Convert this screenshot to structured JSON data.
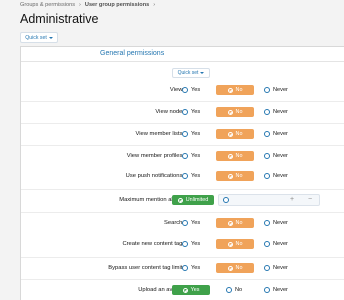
{
  "breadcrumbs": [
    "Groups & permissions",
    "User group permissions"
  ],
  "page_title": "Administrative",
  "quick_set_label": "Quick set",
  "section_title": "General permissions",
  "option_labels": {
    "yes": "Yes",
    "no": "No",
    "never": "Never",
    "unlimited": "Unlimited"
  },
  "rows": [
    {
      "label": "View:",
      "value": "No"
    },
    {
      "label": "View node:",
      "value": "No"
    },
    {
      "label": "View member lists:",
      "value": "No"
    },
    {
      "label": "View member profiles:",
      "value": "No"
    },
    {
      "label": "Use push notifications:",
      "value": "No"
    },
    {
      "label": "Maximum mention alerts:",
      "value": "Unlimited"
    },
    {
      "label": "Search:",
      "value": "No"
    },
    {
      "label": "Create new content tag:",
      "value": "No"
    },
    {
      "label": "Bypass user content tag limit:",
      "value": "No"
    },
    {
      "label": "Upload an avatar:",
      "value": "Yes"
    }
  ],
  "colors": {
    "accent": "#2577b1",
    "no_selected": "#f0a35a",
    "yes_selected": "#3fa14a"
  },
  "icons": [
    "caret-down-icon",
    "check-circle-icon",
    "radio-icon",
    "plus-icon",
    "minus-icon"
  ]
}
